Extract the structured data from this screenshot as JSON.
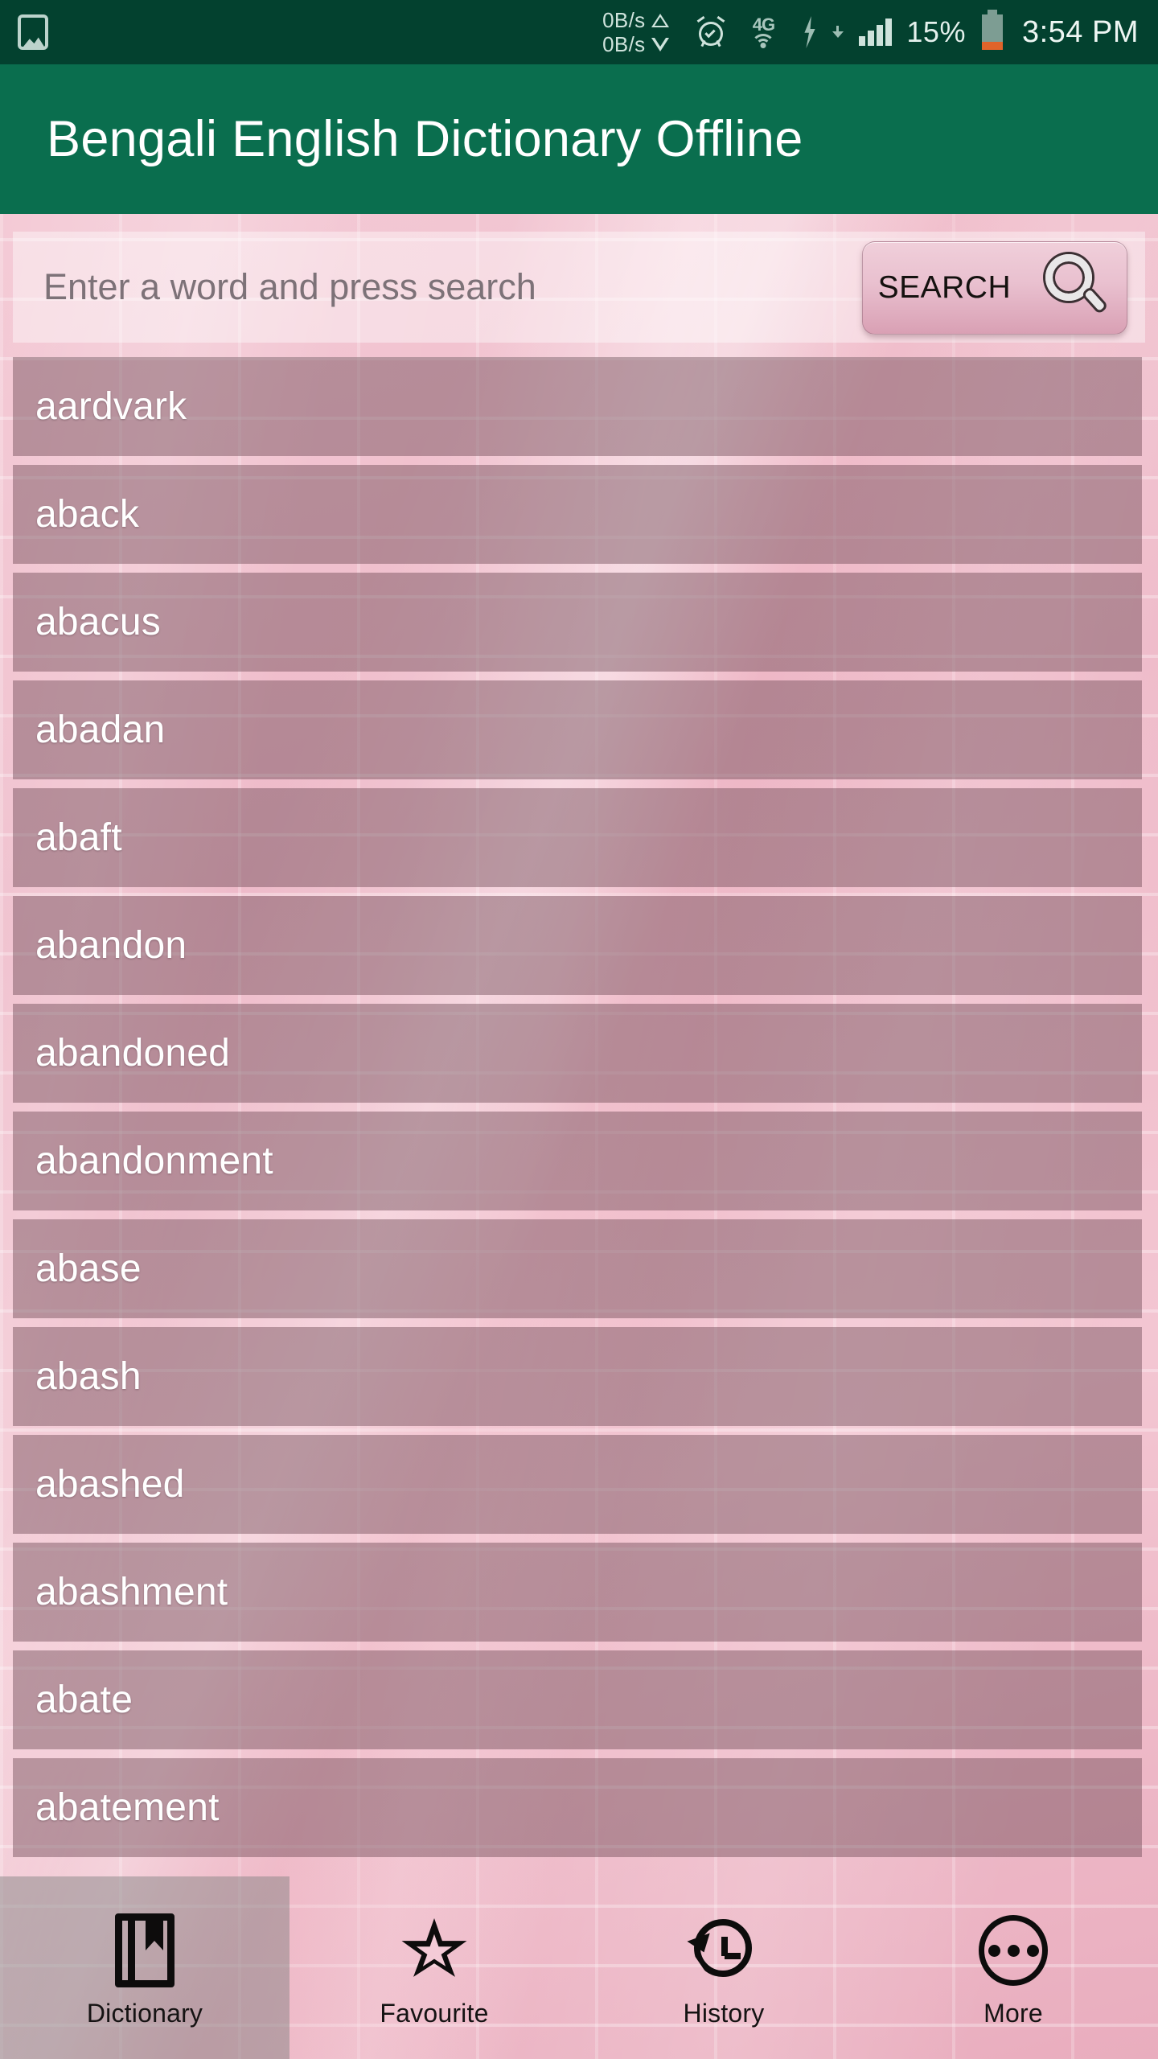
{
  "status_bar": {
    "left_icon": "photo-icon",
    "net_up": "0B/s",
    "net_down": "0B/s",
    "alarm_icon": "alarm-icon",
    "network_type": "4G",
    "signal_icon": "signal-bars-icon",
    "battery_percent": "15%",
    "clock": "3:54 PM",
    "bg_color": "#03412f",
    "fg_color": "#cfe3dc"
  },
  "app_bar": {
    "title": "Bengali English Dictionary Offline",
    "bg_color": "#0a6e4e",
    "title_color": "#ffffff"
  },
  "search": {
    "placeholder": "Enter a word and press search",
    "value": "",
    "button_label": "SEARCH",
    "button_icon": "magnifier-icon"
  },
  "word_list": {
    "items": [
      "aardvark",
      "aback",
      "abacus",
      "abadan",
      "abaft",
      "abandon",
      "abandoned",
      "abandonment",
      "abase",
      "abash",
      "abashed",
      "abashment",
      "abate",
      "abatement"
    ]
  },
  "bottom_nav": {
    "items": [
      {
        "label": "Dictionary",
        "icon": "book-icon",
        "selected": true
      },
      {
        "label": "Favourite",
        "icon": "star-icon",
        "selected": false
      },
      {
        "label": "History",
        "icon": "history-icon",
        "selected": false
      },
      {
        "label": "More",
        "icon": "more-icon",
        "selected": false
      }
    ]
  },
  "theme": {
    "wallpaper": "pink-brick-wall",
    "accent": "#0a6e4e",
    "row_overlay": "rgba(107,70,82,0.44)"
  }
}
